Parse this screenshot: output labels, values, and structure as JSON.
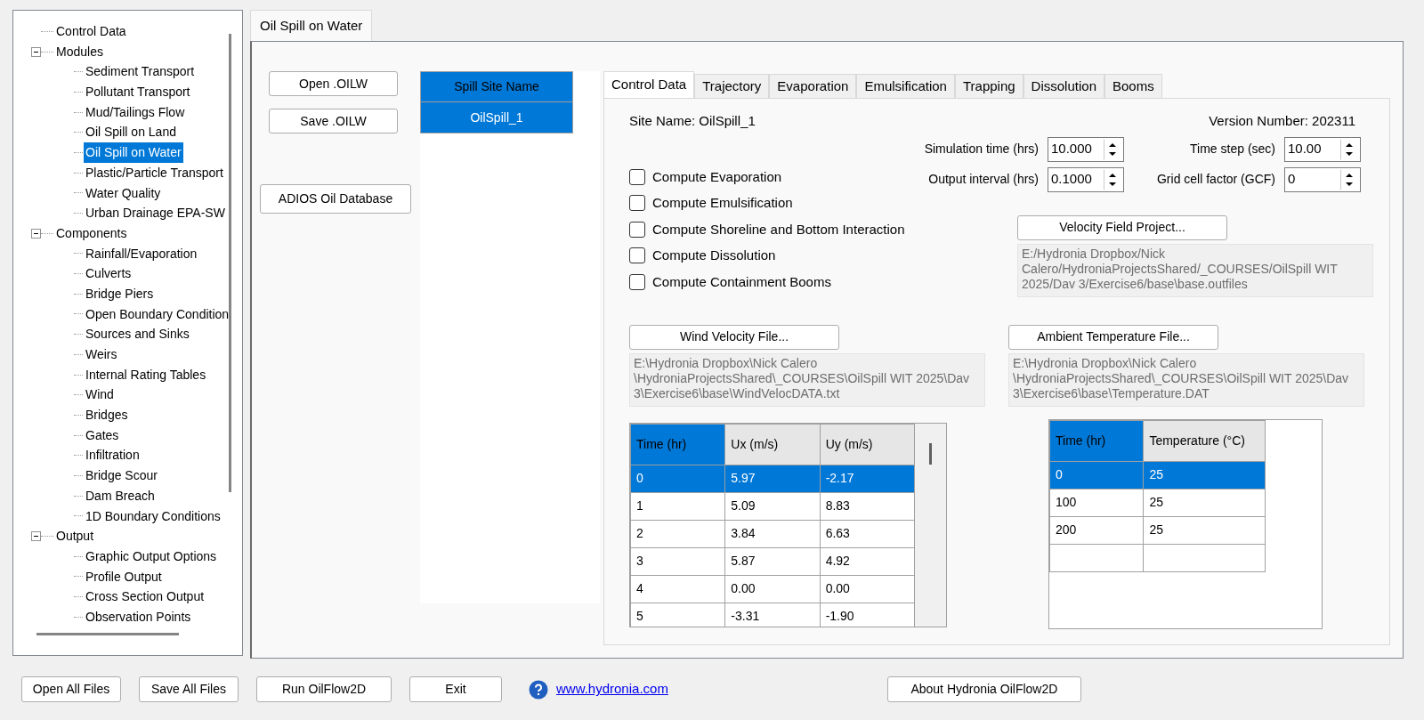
{
  "tree": [
    {
      "label": "Control Data",
      "selected": false
    },
    {
      "label": "Modules",
      "expanded": true,
      "selected": false,
      "children": [
        {
          "label": "Sediment Transport",
          "selected": false
        },
        {
          "label": "Pollutant Transport",
          "selected": false
        },
        {
          "label": "Mud/Tailings Flow",
          "selected": false
        },
        {
          "label": "Oil Spill on Land",
          "selected": false
        },
        {
          "label": "Oil Spill on Water",
          "selected": true
        },
        {
          "label": "Plastic/Particle Transport",
          "selected": false
        },
        {
          "label": "Water Quality",
          "selected": false
        },
        {
          "label": "Urban Drainage EPA-SW",
          "selected": false
        }
      ]
    },
    {
      "label": "Components",
      "expanded": true,
      "selected": false,
      "children": [
        {
          "label": "Rainfall/Evaporation",
          "selected": false
        },
        {
          "label": "Culverts",
          "selected": false
        },
        {
          "label": "Bridge Piers",
          "selected": false
        },
        {
          "label": "Open Boundary Condition",
          "selected": false
        },
        {
          "label": "Sources and Sinks",
          "selected": false
        },
        {
          "label": "Weirs",
          "selected": false
        },
        {
          "label": "Internal Rating Tables",
          "selected": false
        },
        {
          "label": "Wind",
          "selected": false
        },
        {
          "label": "Bridges",
          "selected": false
        },
        {
          "label": "Gates",
          "selected": false
        },
        {
          "label": "Infiltration",
          "selected": false
        },
        {
          "label": "Bridge Scour",
          "selected": false
        },
        {
          "label": "Dam Breach",
          "selected": false
        },
        {
          "label": "1D Boundary Conditions",
          "selected": false
        }
      ]
    },
    {
      "label": "Output",
      "expanded": true,
      "selected": false,
      "children": [
        {
          "label": "Graphic Output Options",
          "selected": false
        },
        {
          "label": "Profile Output",
          "selected": false
        },
        {
          "label": "Cross Section Output",
          "selected": false
        },
        {
          "label": "Observation Points",
          "selected": false
        }
      ]
    }
  ],
  "page_tab": {
    "label": "Oil Spill on Water",
    "selected": true
  },
  "file_buttons": [
    "Open .OILW",
    "Save .OILW"
  ],
  "database_button": "ADIOS Oil Database",
  "spill_sites": {
    "header": "Spill Site Name",
    "rows": [
      {
        "label": "OilSpill_1",
        "selected": true
      }
    ]
  },
  "tabs": [
    {
      "label": "Control Data",
      "selected": true
    },
    {
      "label": "Trajectory",
      "selected": false
    },
    {
      "label": "Evaporation",
      "selected": false
    },
    {
      "label": "Emulsification",
      "selected": false
    },
    {
      "label": "Trapping",
      "selected": false
    },
    {
      "label": "Dissolution",
      "selected": false
    },
    {
      "label": "Booms",
      "selected": false
    }
  ],
  "site_name": "Site Name: OilSpill_1",
  "version": "Version Number: 202311",
  "spin_fields": [
    {
      "label": "Simulation time (hrs)",
      "value": "10.000"
    },
    {
      "label": "Time step (sec)",
      "value": "10.00"
    },
    {
      "label": "Output interval (hrs)",
      "value": "0.1000"
    },
    {
      "label": "Grid cell factor (GCF)",
      "value": "0"
    }
  ],
  "options": [
    {
      "label": "Compute Evaporation",
      "checked": false
    },
    {
      "label": "Compute Emulsification",
      "checked": false
    },
    {
      "label": "Compute Shoreline and Bottom Interaction",
      "checked": false
    },
    {
      "label": "Compute Dissolution",
      "checked": false
    },
    {
      "label": "Compute Containment Booms",
      "checked": false
    }
  ],
  "velocity_field": {
    "button": "Velocity Field Project...",
    "path": "E:/Hydronia Dropbox/Nick Calero/HydroniaProjectsShared/_COURSES/OilSpill WIT 2025/Dav  3/Exercise6/base\\base.outfiles"
  },
  "wind": {
    "button": "Wind Velocity File...",
    "path": "E:\\Hydronia Dropbox\\Nick Calero \\HydroniaProjectsShared\\_COURSES\\OilSpill WIT 2025\\Dav  3\\Exercise6\\base\\WindVelocDATA.txt",
    "columns": [
      {
        "label": "Time (hr)",
        "selected": true
      },
      {
        "label": "Ux (m/s)",
        "selected": false
      },
      {
        "label": "Uy (m/s)",
        "selected": false
      }
    ],
    "rows": [
      {
        "cells": [
          "0",
          "5.97",
          "-2.17"
        ],
        "selected": true
      },
      {
        "cells": [
          "1",
          "5.09",
          "8.83"
        ],
        "selected": false
      },
      {
        "cells": [
          "2",
          "3.84",
          "6.63"
        ],
        "selected": false
      },
      {
        "cells": [
          "3",
          "5.87",
          "4.92"
        ],
        "selected": false
      },
      {
        "cells": [
          "4",
          "0.00",
          "0.00"
        ],
        "selected": false
      },
      {
        "cells": [
          "5",
          "-3.31",
          "-1.90"
        ],
        "selected": false
      }
    ]
  },
  "temperature": {
    "button": "Ambient Temperature File...",
    "path": "E:\\Hydronia Dropbox\\Nick Calero \\HydroniaProjectsShared\\_COURSES\\OilSpill WIT 2025\\Dav  3\\Exercise6\\base\\Temperature.DAT",
    "columns": [
      {
        "label": "Time (hr)",
        "selected": true
      },
      {
        "label": "Temperature (°C)",
        "selected": false
      }
    ],
    "rows": [
      {
        "cells": [
          "0",
          "25"
        ],
        "selected": true
      },
      {
        "cells": [
          "100",
          "25"
        ],
        "selected": false
      },
      {
        "cells": [
          "200",
          "25"
        ],
        "selected": false
      },
      {
        "cells": [],
        "selected": false
      }
    ]
  },
  "bottom_buttons": [
    "Open All Files",
    "Save All Files",
    "Run OilFlow2D",
    "Exit"
  ],
  "link": "www.hydronia.com",
  "about_button": "About Hydronia OilFlow2D"
}
